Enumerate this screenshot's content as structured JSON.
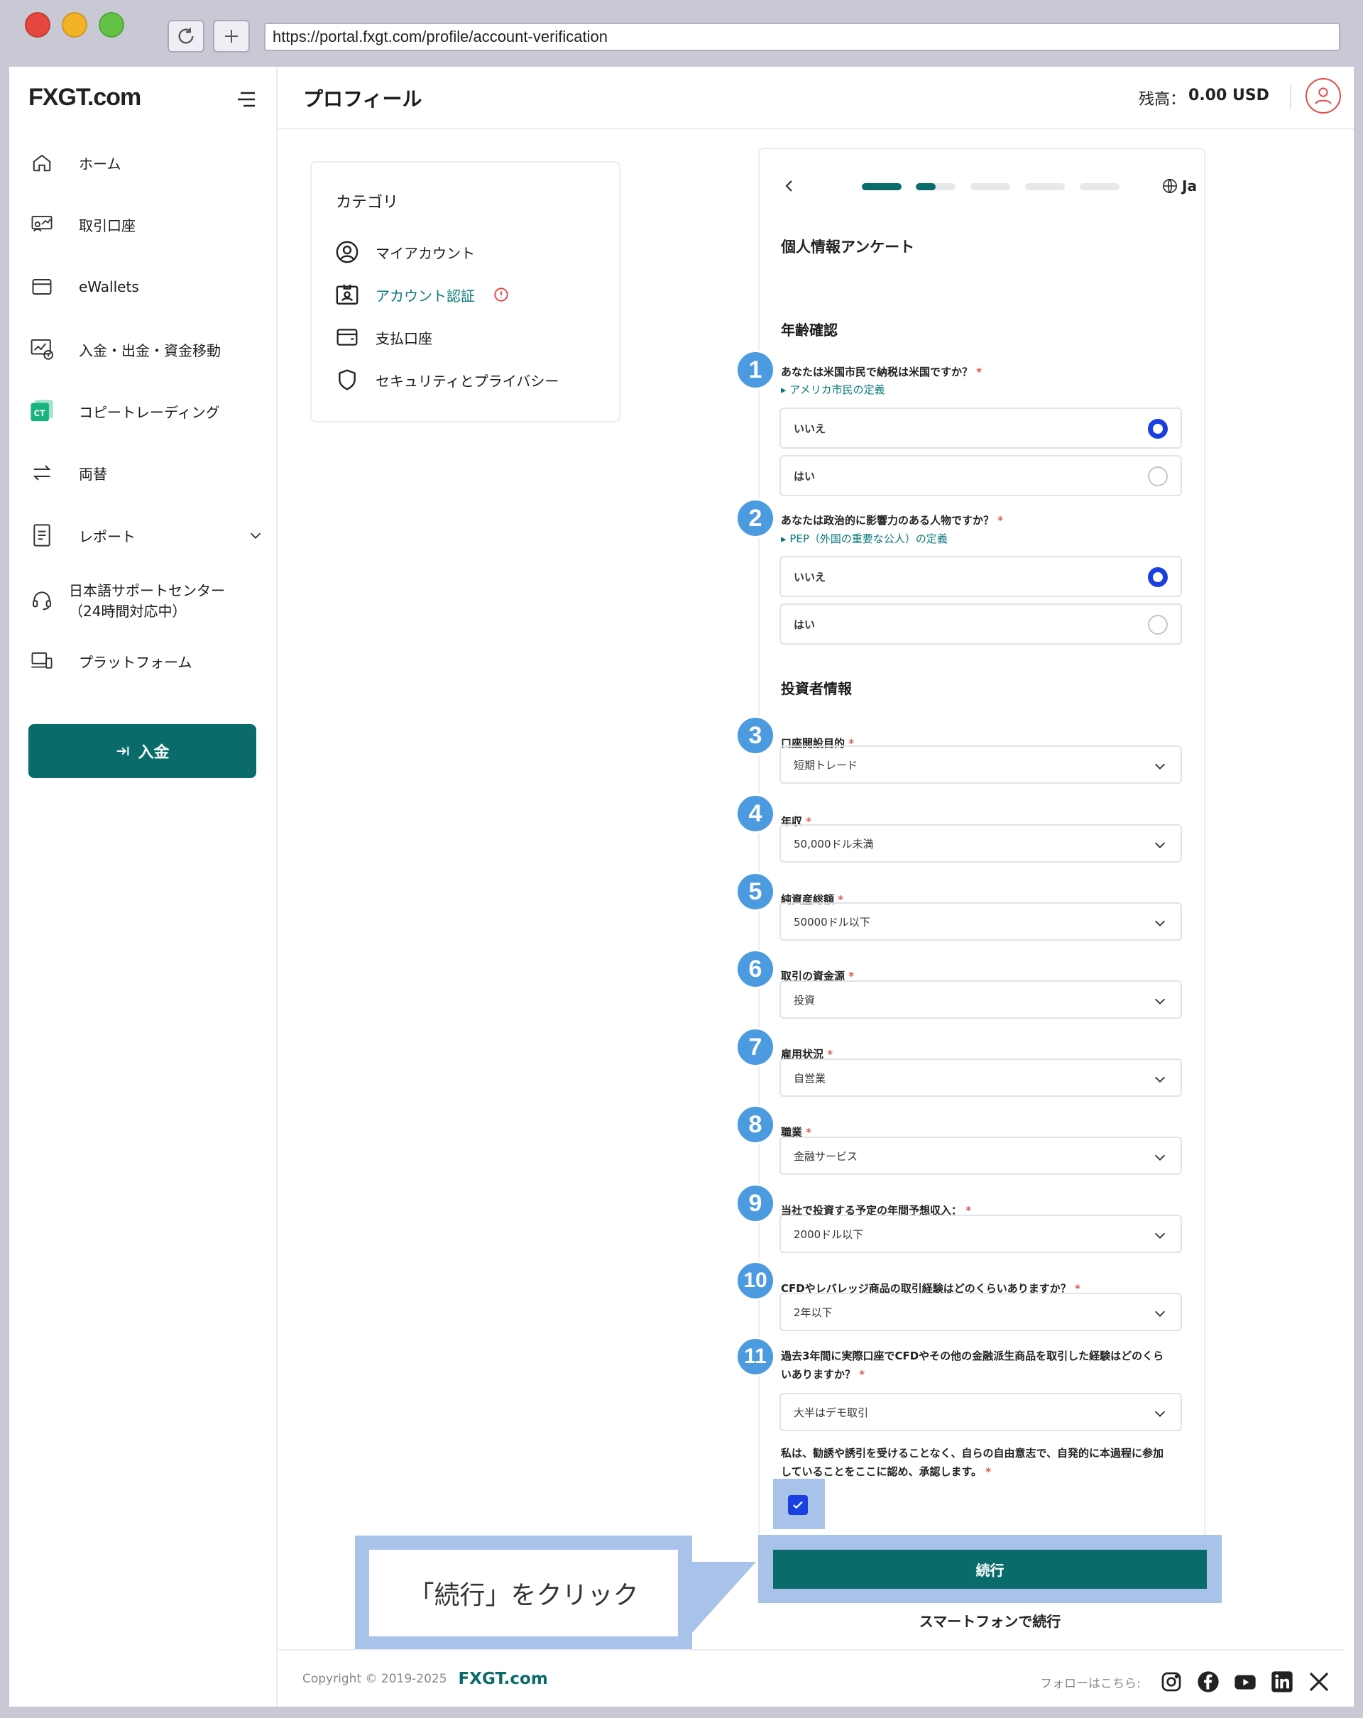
{
  "browser": {
    "url": "https://portal.fxgt.com/profile/account-verification"
  },
  "brand": {
    "logo_text": "FXGT.com",
    "accent": "#0a6b6b",
    "radio_color": "#1a3fe0",
    "badge_color": "#4c9be0",
    "highlight_color": "#a9c2ea"
  },
  "sidebar": {
    "items": [
      {
        "label": "ホーム",
        "icon": "home-icon"
      },
      {
        "label": "取引口座",
        "icon": "trading-account-icon"
      },
      {
        "label": "eWallets",
        "icon": "wallet-icon"
      },
      {
        "label": "入金・出金・資金移動",
        "icon": "funds-transfer-icon"
      },
      {
        "label": "コピートレーディング",
        "icon": "copy-trading-icon"
      },
      {
        "label": "両替",
        "icon": "exchange-icon"
      },
      {
        "label": "レポート",
        "icon": "report-icon"
      },
      {
        "label": "日本語サポートセンター",
        "label2": "（24時間対応中）",
        "icon": "headset-icon"
      },
      {
        "label": "プラットフォーム",
        "icon": "platform-icon"
      }
    ],
    "deposit_button": "入金"
  },
  "header": {
    "title": "プロフィール",
    "balance_label": "残高：",
    "balance_value": "0.00 USD"
  },
  "category": {
    "title": "カテゴリ",
    "items": [
      {
        "label": "マイアカウント"
      },
      {
        "label": "アカウント認証"
      },
      {
        "label": "支払口座"
      },
      {
        "label": "セキュリティとプライバシー"
      }
    ]
  },
  "stepper": {
    "lang": "Ja",
    "steps": 5,
    "current_step": 2,
    "current_step_progress": 0.5
  },
  "form": {
    "title": "個人情報アンケート",
    "age_section": "年齢確認",
    "q1": {
      "badge": "1",
      "label": "あなたは米国市民で納税は米国ですか？",
      "link": "アメリカ市民の定義",
      "options": [
        "いいえ",
        "はい"
      ],
      "selected": 0
    },
    "q2": {
      "badge": "2",
      "label": "あなたは政治的に影響力のある人物ですか？",
      "link": "PEP（外国の重要な公人）の定義",
      "options": [
        "いいえ",
        "はい"
      ],
      "selected": 0
    },
    "investor_section": "投資者情報",
    "selects": [
      {
        "badge": "3",
        "label": "口座開設目的",
        "value": "短期トレード"
      },
      {
        "badge": "4",
        "label": "年収",
        "value": "50,000ドル未満"
      },
      {
        "badge": "5",
        "label": "純資産総額",
        "value": "50000ドル以下"
      },
      {
        "badge": "6",
        "label": "取引の資金源",
        "value": "投資"
      },
      {
        "badge": "7",
        "label": "雇用状況",
        "value": "自営業"
      },
      {
        "badge": "8",
        "label": "職業",
        "value": "金融サービス"
      },
      {
        "badge": "9",
        "label": "当社で投資する予定の年間予想収入：",
        "value": "2000ドル以下"
      },
      {
        "badge": "10",
        "label": "CFDやレバレッジ商品の取引経験はどのくらいありますか？",
        "value": "2年以下"
      }
    ],
    "q11": {
      "badge": "11",
      "label1": "過去3年間に実際口座でCFDやその他の金融派生商品を取引した経験はどのくら",
      "label2": "いありますか？",
      "value": "大半はデモ取引"
    },
    "consent1": "私は、勧誘や誘引を受けることなく、自らの自由意志で、自発的に本過程に参加",
    "consent2": "していることをここに認め、承認します。",
    "consent_checked": true,
    "continue_button": "続行",
    "smartphone_link": "スマートフォンで続行"
  },
  "callout": {
    "text": "「続行」をクリック"
  },
  "footer": {
    "copyright": "Copyright © 2019-2025",
    "brand": "FXGT.com",
    "follow": "フォローはこちら:",
    "socials": [
      "instagram-icon",
      "facebook-icon",
      "youtube-icon",
      "linkedin-icon",
      "x-icon"
    ]
  }
}
